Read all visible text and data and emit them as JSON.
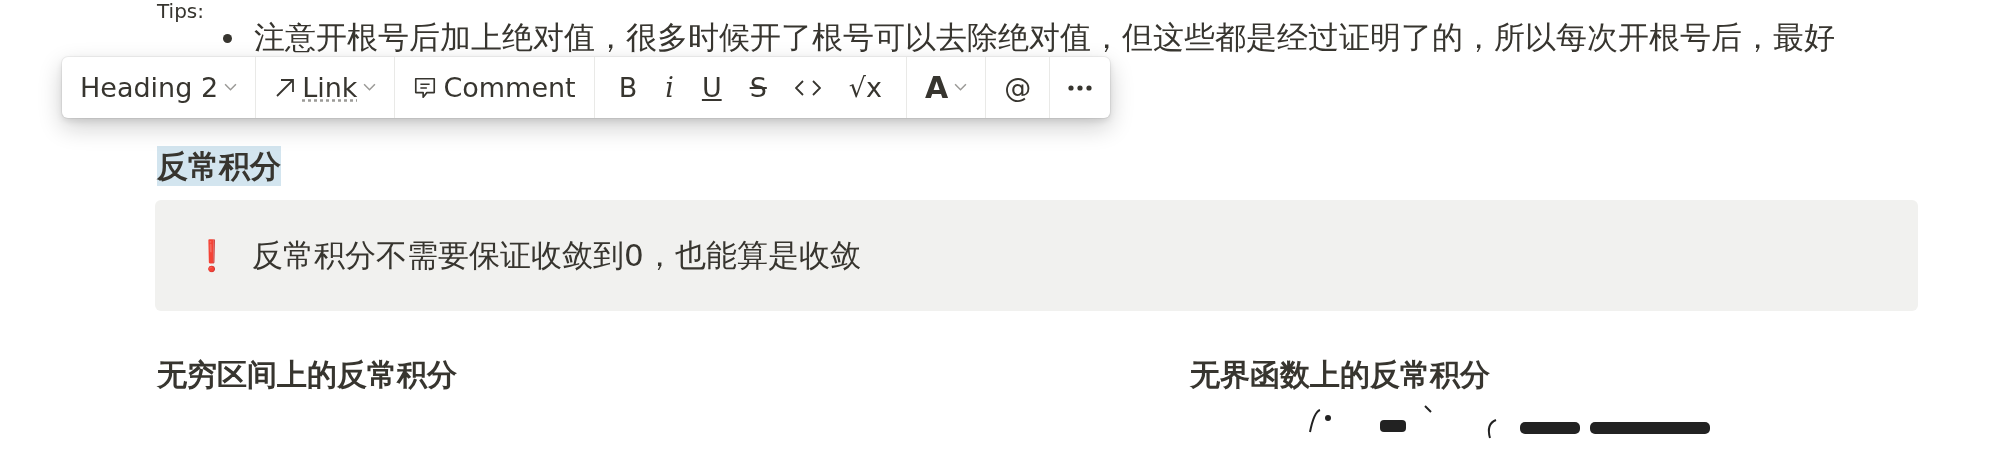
{
  "document": {
    "intro": "Tips:",
    "bullets": [
      "注意开根号后加上绝对值，很多时候开了根号可以去除绝对值，但这些都是经过证明了的，所以每次开根号后，最好"
    ],
    "heading": {
      "text": "反常积分",
      "selected": true
    },
    "callout": {
      "icon": "❗",
      "text": "反常积分不需要保证收敛到0，也能算是收敛"
    },
    "columns": [
      {
        "heading": "无穷区间上的反常积分"
      },
      {
        "heading": "无界函数上的反常积分",
        "kind": "picture"
      }
    ]
  },
  "toolbar": {
    "block_type": "Heading 2",
    "link": "Link",
    "comment": "Comment",
    "formats": [
      {
        "kind": "bold",
        "label": "B"
      },
      {
        "kind": "italic",
        "label": "i"
      },
      {
        "kind": "underline",
        "label": "U"
      },
      {
        "kind": "strike",
        "label": "S"
      },
      {
        "kind": "code"
      },
      {
        "kind": "equation",
        "label": "√x"
      }
    ],
    "text_color_label": "A",
    "mention": "@"
  }
}
